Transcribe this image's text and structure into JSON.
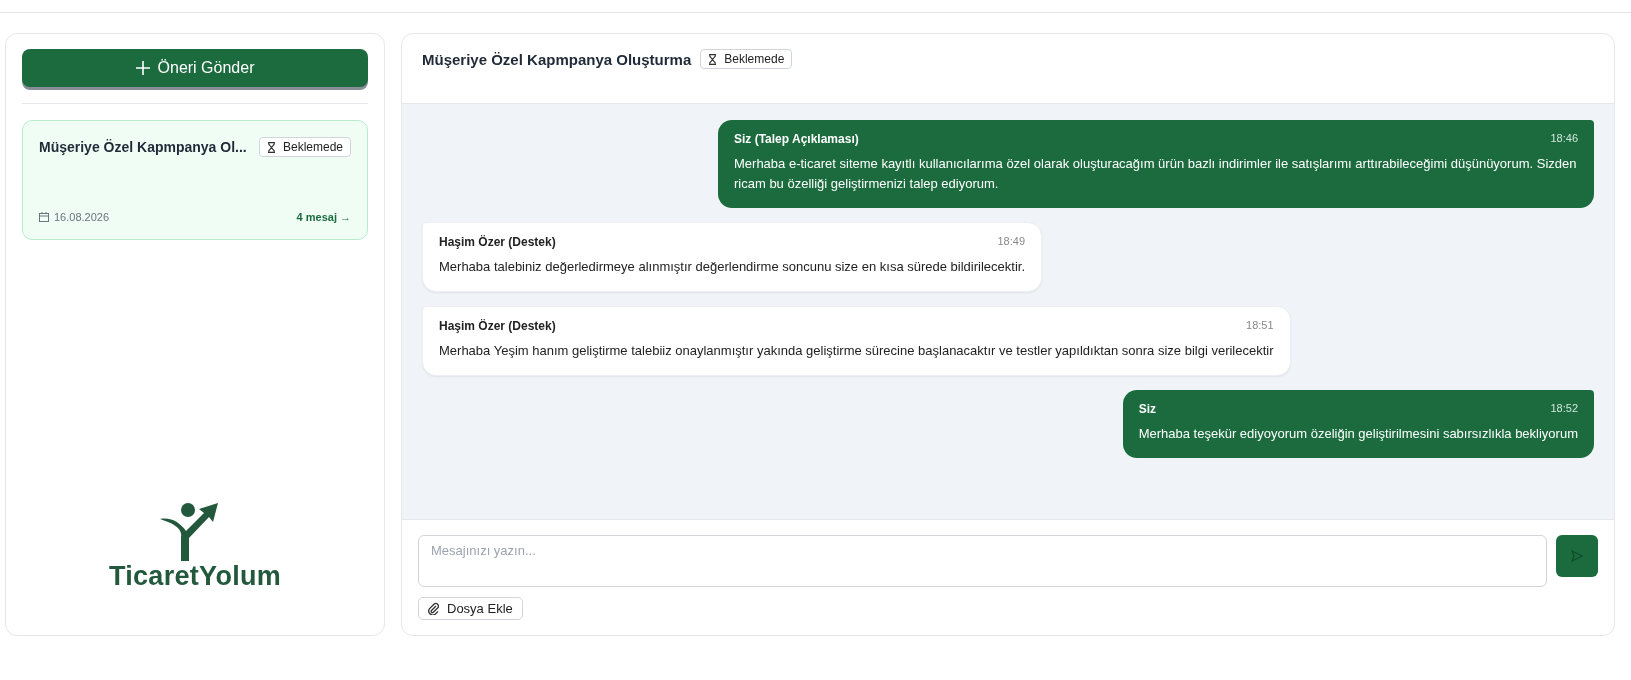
{
  "sidebar": {
    "new_button": {
      "label": "Öneri Gönder"
    },
    "tickets": [
      {
        "title": "Müşeriye Özel Kapmpanya Ol...",
        "status": "Beklemede",
        "date": "16.08.2026",
        "messages": "4 mesaj →",
        "selected": true
      }
    ],
    "logo": {
      "text": "TicaretYolum"
    }
  },
  "conversation": {
    "title": "Müşeriye Özel Kapmpanya Oluşturma",
    "status": "Beklemede",
    "messages": [
      {
        "kind": "sent",
        "sender": "Siz (Talep Açıklaması)",
        "time": "18:46",
        "text": "Merhaba e-ticaret siteme kayıtlı kullanıcılarıma özel olarak oluşturacağım ürün bazlı indirimler ile satışlarımı arttırabileceğimi düşünüyorum. Sizden ricam bu özelliği geliştirmenizi talep ediyorum."
      },
      {
        "kind": "received",
        "sender": "Haşim Özer (Destek)",
        "time": "18:49",
        "text": "Merhaba talebiniz değerledirmeye alınmıştır değerlendirme soncunu size en kısa sürede bildirilecektir."
      },
      {
        "kind": "received",
        "sender": "Haşim Özer (Destek)",
        "time": "18:51",
        "text": "Merhaba Yeşim hanım geliştirme talebiiz onaylanmıştır yakında geliştirme sürecine başlanacaktır ve testler yapıldıktan sonra size bilgi verilecektir"
      },
      {
        "kind": "sent",
        "sender": "Siz",
        "time": "18:52",
        "text": "Merhaba teşekür ediyoyorum özeliğin geliştirilmesini sabırsızlıkla bekliyorum"
      }
    ],
    "composer": {
      "placeholder": "Mesajınızı yazın...",
      "attach_label": "Dosya Ekle"
    }
  }
}
